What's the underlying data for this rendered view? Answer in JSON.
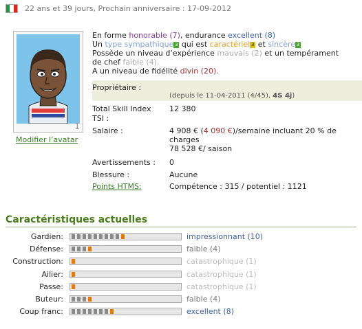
{
  "header": {
    "age_text": "22 ans et 39 jours, Prochain anniversaire : 17-09-2012",
    "flag_colors": [
      "#1a9a3a",
      "#ffffff",
      "#d52b1e"
    ]
  },
  "avatar": {
    "number": "1",
    "edit_link": "Modifier l’avatar"
  },
  "description": {
    "form_prefix": "En forme",
    "form_value": "honorable",
    "form_num": "(7)",
    "endurance_prefix": ", endurance",
    "endurance_value": "excellent",
    "endurance_num": "(8)",
    "a_prefix": "Un",
    "type_value": "type sympathique",
    "type_level": "3",
    "qui_est": "qui est",
    "caractere_value": "caractériel",
    "caractere_level": "3",
    "et": "et",
    "sincere_value": "sincère",
    "sincere_level": "3",
    "experience_prefix": "Possède un niveau d’expérience",
    "experience_value": "mauvais",
    "experience_num": "(2)",
    "experience_suffix": "et un tempérament",
    "chef_prefix": "de chef",
    "chef_value": "faible",
    "chef_num": "(4).",
    "fidelity_prefix": "A un niveau de fidélité",
    "fidelity_value": "divin",
    "fidelity_num": "(20)."
  },
  "owner": {
    "label": "Propriétaire :",
    "since_text": "(depuis le 11-04-2011 (4/45),",
    "since_bold": "4S 4j",
    "since_close": ")"
  },
  "info": {
    "tsi_label": "Total Skill Index",
    "tsi_value": "12 380",
    "tsi_short_label": "TSI :",
    "salary_label": "Salaire :",
    "salary_line1": "4 908 € (",
    "salary_line1_red": "4 090 €",
    "salary_line1_end": ")/semaine incluant 20 % de",
    "salary_line2": "charges",
    "salary_line3": "78 528 €/ saison",
    "warnings_label": "Avertissements :",
    "warnings_value": "0",
    "injury_label": "Blessure :",
    "injury_value": "Aucune",
    "htms_label": "Points HTMS:",
    "htms_value": "Compétence : 315 / potentiel : 1121"
  },
  "skills_title": "Caractéristiques actuelles",
  "skills": [
    {
      "name": "Gardien:",
      "level": "impressionnant",
      "num": "(10)",
      "value": 10,
      "color": "#3b5fa0"
    },
    {
      "name": "Défense:",
      "level": "faible",
      "num": "(4)",
      "value": 4,
      "color": "#777777"
    },
    {
      "name": "Construction:",
      "level": "catastrophique",
      "num": "(1)",
      "value": 1,
      "color": "#bbbbbb"
    },
    {
      "name": "Ailier:",
      "level": "catastrophique",
      "num": "(1)",
      "value": 1,
      "color": "#bbbbbb"
    },
    {
      "name": "Passe:",
      "level": "catastrophique",
      "num": "(1)",
      "value": 1,
      "color": "#bbbbbb"
    },
    {
      "name": "Buteur:",
      "level": "faible",
      "num": "(4)",
      "value": 4,
      "color": "#777777"
    },
    {
      "name": "Coup franc:",
      "level": "excellent",
      "num": "(8)",
      "value": 8,
      "color": "#3b5fa0"
    }
  ]
}
